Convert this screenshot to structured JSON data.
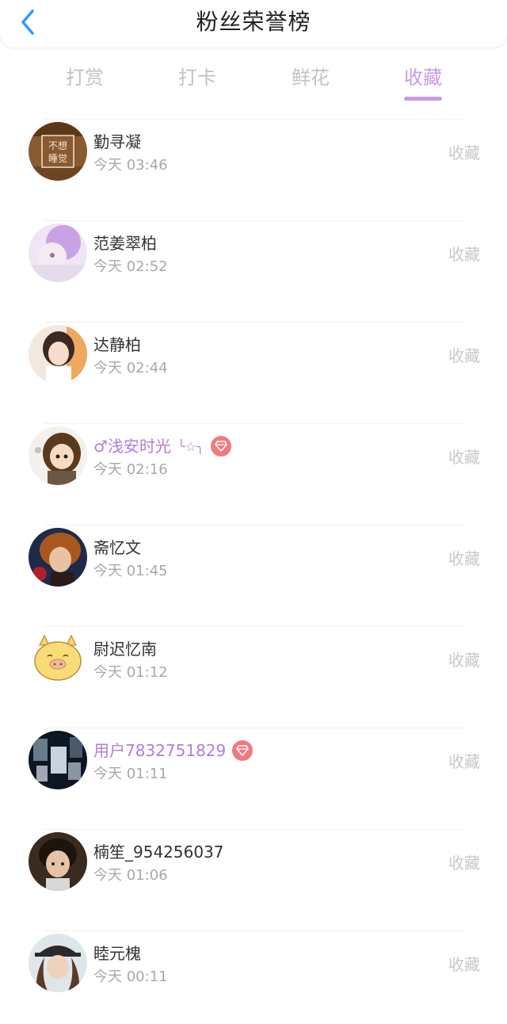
{
  "header": {
    "title": "粉丝荣誉榜",
    "back_icon": "chevron-left-icon",
    "accent": "#2f9bff"
  },
  "tabs": [
    {
      "label": "打赏"
    },
    {
      "label": "打卡"
    },
    {
      "label": "鲜花"
    },
    {
      "label": "收藏",
      "active": true
    }
  ],
  "colors": {
    "active_tab": "#c79be6",
    "vip_name": "#b07ed8",
    "gem_badge": "#f07a80"
  },
  "fans": [
    {
      "name": "勤寻凝",
      "time": "今天 03:46",
      "action": "收藏",
      "vip": false,
      "avatar_text": [
        "不想",
        "睡觉"
      ]
    },
    {
      "name": "范姜翠柏",
      "time": "今天 02:52",
      "action": "收藏",
      "vip": false
    },
    {
      "name": "达静柏",
      "time": "今天 02:44",
      "action": "收藏",
      "vip": false
    },
    {
      "name": "♂浅安时光",
      "deco": "╰☆╮",
      "time": "今天 02:16",
      "action": "收藏",
      "vip": true,
      "badge": "gem-icon"
    },
    {
      "name": "斋忆文",
      "time": "今天 01:45",
      "action": "收藏",
      "vip": false
    },
    {
      "name": "尉迟忆南",
      "time": "今天 01:12",
      "action": "收藏",
      "vip": false
    },
    {
      "name": "用户7832751829",
      "time": "今天 01:11",
      "action": "收藏",
      "vip": true,
      "badge": "gem-icon"
    },
    {
      "name": "楠笙_954256037",
      "time": "今天 01:06",
      "action": "收藏",
      "vip": false
    },
    {
      "name": "睦元槐",
      "time": "今天 00:11",
      "action": "收藏",
      "vip": false
    }
  ]
}
